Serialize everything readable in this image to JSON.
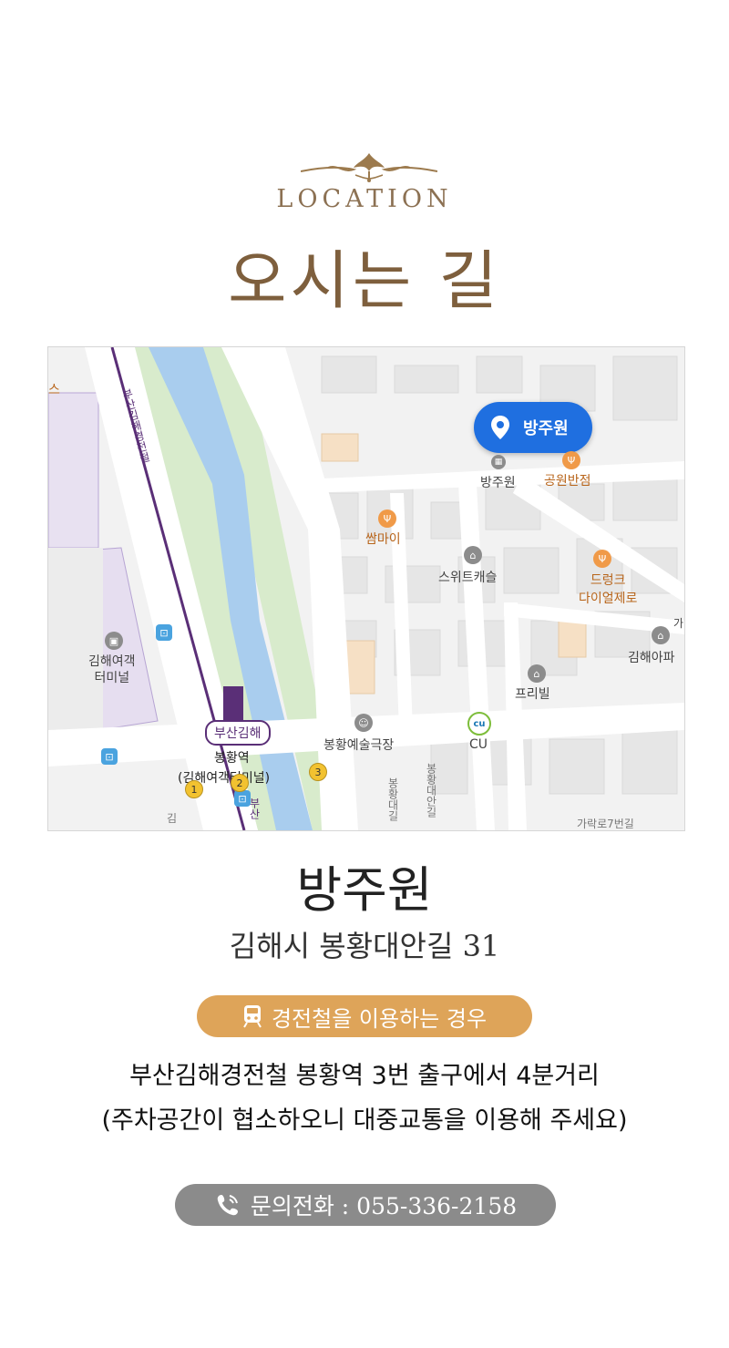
{
  "header": {
    "eyebrow": "LOCATION",
    "title": "오시는 길"
  },
  "map": {
    "marker_label": "방주원",
    "station_badge": "부산김해",
    "labels": {
      "edge_s": "스",
      "rail_line": "부산김해경전철",
      "terminal": "김해여객\n터미널",
      "station_name": "봉황역",
      "station_sub": "(김해여객터미널)",
      "bangjuwon": "방주원",
      "gongwon": "공원반점",
      "ssammai": "쌈마이",
      "sweet": "스위트캐슬",
      "drunk": "드렁크\n다이얼제로",
      "gimhae_apt": "김해아파",
      "ga": "가",
      "freeville": "프리빌",
      "theater": "봉황예술극장",
      "cu": "CU",
      "road1": "봉황대길",
      "road2": "봉황대안길",
      "road3": "가락로7번길",
      "gim": "김",
      "busan": "부산",
      "exit3": "3",
      "exit1": "1",
      "exit2": "2"
    },
    "colors": {
      "river": "#a9cdee",
      "green": "#cfe7c1",
      "rail": "#5a2f77",
      "marker": "#1f6fe0"
    }
  },
  "place": {
    "name": "방주원",
    "address": "김해시 봉황대안길 31"
  },
  "transit": {
    "label": "경전철을 이용하는 경우",
    "icon": "train-icon",
    "color": "#dea459",
    "line1": "부산김해경전철 봉황역 3번 출구에서 4분거리",
    "line2": "(주차공간이 협소하오니 대중교통을 이용해 주세요)"
  },
  "contact": {
    "label": "문의전화 : 055-336-2158",
    "icon": "phone-icon",
    "color": "#8b8b8b"
  }
}
